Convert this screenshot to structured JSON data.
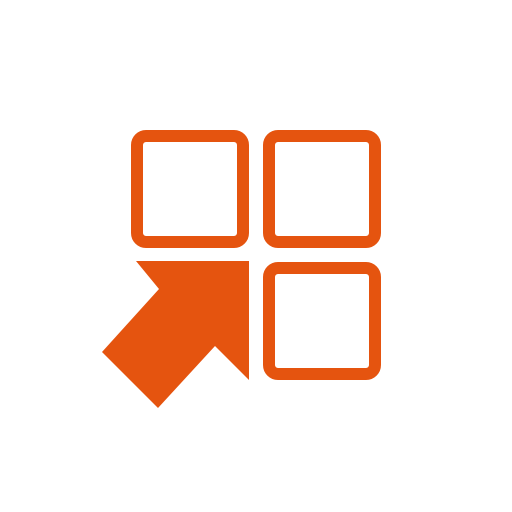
{
  "icon": {
    "name": "app-grid-add-icon",
    "accent_color": "#e5540f",
    "background_color": "#ffffff",
    "parts": [
      "grid-tile-top-left",
      "grid-tile-top-right",
      "grid-tile-bottom-right",
      "arrow-up-right"
    ]
  }
}
